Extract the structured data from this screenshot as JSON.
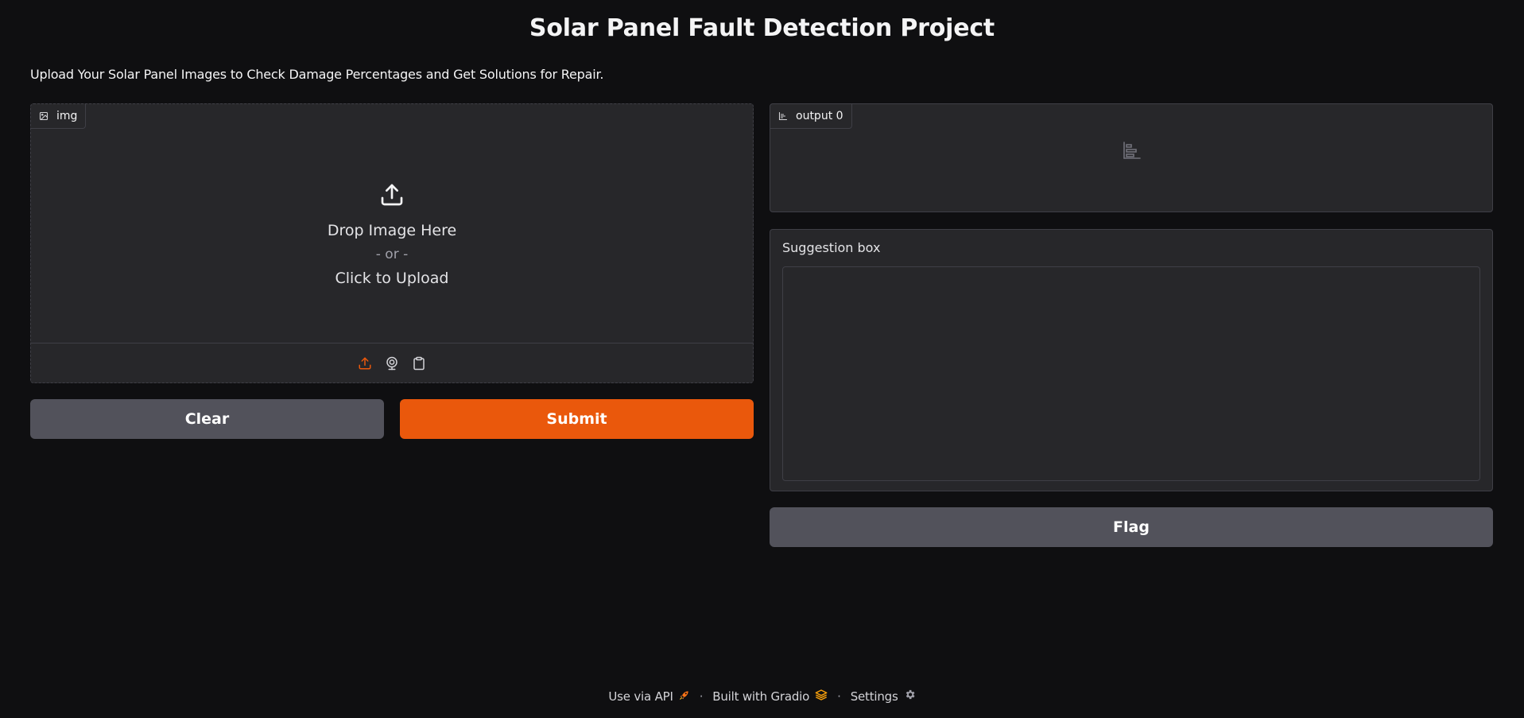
{
  "header": {
    "title": "Solar Panel Fault Detection Project",
    "description": "Upload Your Solar Panel Images to Check Damage Percentages and Get Solutions for Repair."
  },
  "image_input": {
    "label": "img",
    "drop_text": "Drop Image Here",
    "or_text": "- or -",
    "click_text": "Click to Upload",
    "sources": [
      "upload-icon",
      "webcam-icon",
      "clipboard-icon"
    ],
    "active_source": "upload-icon"
  },
  "buttons": {
    "clear": "Clear",
    "submit": "Submit",
    "flag": "Flag"
  },
  "plot_output": {
    "label": "output 0",
    "icon": "bar-chart-icon"
  },
  "suggestion_box": {
    "label": "Suggestion box",
    "value": ""
  },
  "footer": {
    "api": "Use via API",
    "built": "Built with Gradio",
    "settings": "Settings",
    "separator": "·"
  },
  "colors": {
    "background": "#0f0f11",
    "panel": "#27272a",
    "border": "#3f3f46",
    "primary": "#ea580c",
    "secondary": "#52525b"
  }
}
